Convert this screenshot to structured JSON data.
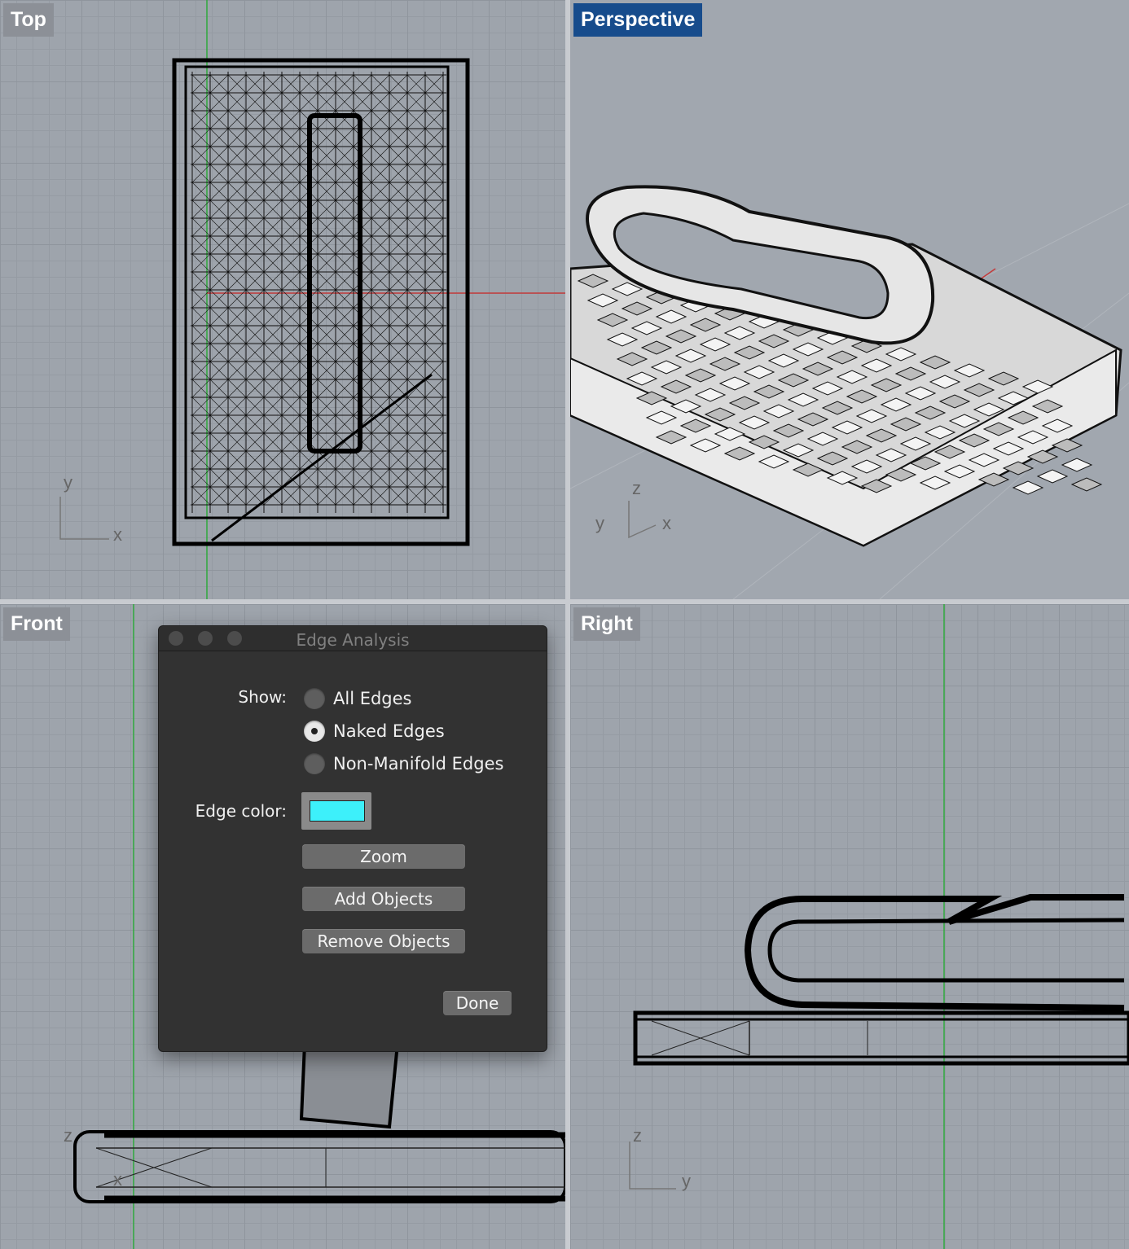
{
  "viewports": {
    "top": {
      "label": "Top",
      "axis_x": "x",
      "axis_y": "y"
    },
    "perspective": {
      "label": "Perspective",
      "axis_x": "x",
      "axis_y": "y",
      "axis_z": "z"
    },
    "front": {
      "label": "Front",
      "axis_x": "x",
      "axis_z": "z"
    },
    "right": {
      "label": "Right",
      "axis_y": "y",
      "axis_z": "z"
    }
  },
  "dialog": {
    "title": "Edge Analysis",
    "show_label": "Show:",
    "options": [
      "All Edges",
      "Naked Edges",
      "Non-Manifold Edges"
    ],
    "selected_option": "Naked Edges",
    "edge_color_label": "Edge color:",
    "edge_color": "#3df0fa",
    "buttons": {
      "zoom": "Zoom",
      "add_objects": "Add Objects",
      "remove_objects": "Remove Objects",
      "done": "Done"
    }
  }
}
